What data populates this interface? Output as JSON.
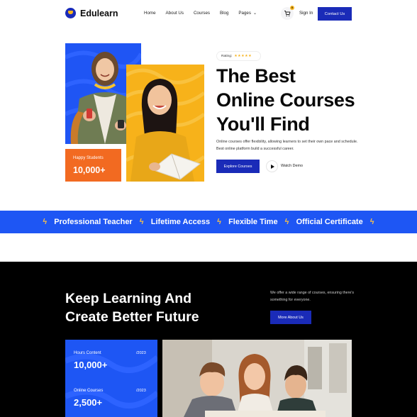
{
  "nav": {
    "brand": "Edulearn",
    "links": [
      "Home",
      "About Us",
      "Courses",
      "Blog",
      "Pages"
    ],
    "cart_count": "0",
    "signin": "Sign In",
    "contact": "Contact Us"
  },
  "hero": {
    "rating_label": "Rating:",
    "stars": "★★★★★",
    "title_lines": [
      "The Best",
      "Online Courses",
      "You'll Find"
    ],
    "description": "Online courses offer flexibility, allowing learners to set their own pace and schedule. Best online platform build a successful career.",
    "explore_button": "Explore Courses",
    "watch_demo": "Watch Demo",
    "students_label": "Happy Students",
    "students_value": "10,000+"
  },
  "band": {
    "items": [
      "Professional Teacher",
      "Lifetime Access",
      "Flexible Time",
      "Official Certificate"
    ]
  },
  "learning": {
    "title_lines": [
      "Keep Learning And",
      "Create Better Future"
    ],
    "description": "We offer a wide range of courses, ensuring there's something for everyone.",
    "more_button": "More About Us",
    "stats": [
      {
        "label": "Hours Content",
        "year": "/2023",
        "value": "10,000+"
      },
      {
        "label": "Online Courses",
        "year": "/2023",
        "value": "2,500+"
      }
    ]
  },
  "colors": {
    "primary": "#1a2bb8",
    "band_blue": "#1e56f4",
    "orange": "#f26a21",
    "yellow": "#f7b21a",
    "dark": "#000000"
  }
}
